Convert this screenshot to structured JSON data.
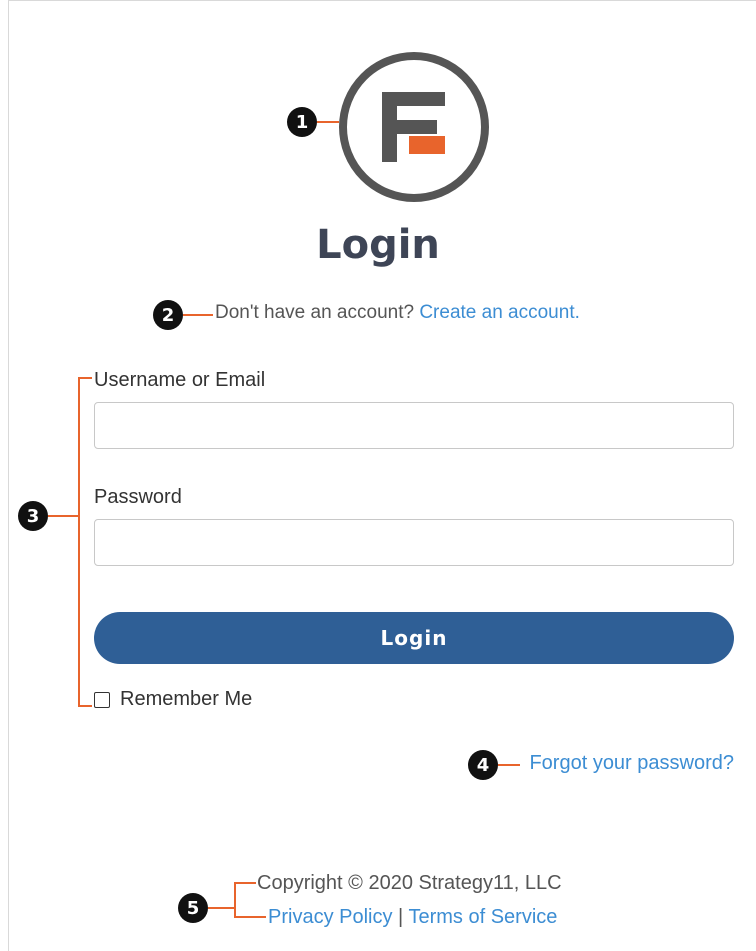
{
  "login": {
    "heading": "Login",
    "signup_prompt": "Don't have an account?",
    "signup_link": "Create an account.",
    "username_label": "Username or Email",
    "username_value": "",
    "password_label": "Password",
    "password_value": "",
    "submit_label": "Login",
    "remember_label": "Remember Me",
    "remember_checked": false,
    "forgot_link": "Forgot your password?"
  },
  "footer": {
    "copyright": "Copyright © 2020 Strategy11, LLC",
    "privacy_link": "Privacy Policy",
    "separator": "|",
    "terms_link": "Terms of Service"
  },
  "callouts": [
    "1",
    "2",
    "3",
    "4",
    "5"
  ],
  "colors": {
    "accent_link": "#3c8dd3",
    "button": "#2f5f96",
    "logo_orange": "#e8642c",
    "logo_gray": "#555555",
    "callout_line": "#e8642c"
  },
  "icons": {
    "logo": "formidable-forms-logo",
    "checkbox": "checkbox-unchecked"
  }
}
